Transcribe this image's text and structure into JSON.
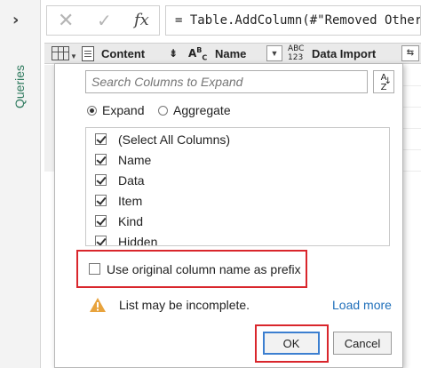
{
  "queries_pane": {
    "toggle_icon": "chevron-right-icon",
    "label": "Queries"
  },
  "formula_bar": {
    "cancel_icon": "close-icon",
    "commit_icon": "check-icon",
    "fx_label": "fx",
    "formula": "= Table.AddColumn(#\"Removed Other Columns\""
  },
  "columns": {
    "content": "Content",
    "abc_icon": "ABC",
    "name": "Name",
    "abc123_top": "ABC",
    "abc123_bottom": "123",
    "data_import": "Data Import"
  },
  "dialog": {
    "search_placeholder": "Search Columns to Expand",
    "sort_top": "A",
    "sort_bottom": "Z",
    "mode_options": [
      {
        "label": "Expand",
        "selected": true
      },
      {
        "label": "Aggregate",
        "selected": false
      }
    ],
    "column_items": [
      {
        "label": "(Select All Columns)",
        "checked": true
      },
      {
        "label": "Name",
        "checked": true
      },
      {
        "label": "Data",
        "checked": true
      },
      {
        "label": "Item",
        "checked": true
      },
      {
        "label": "Kind",
        "checked": true
      },
      {
        "label": "Hidden",
        "checked": true
      }
    ],
    "prefix_option": {
      "label": "Use original column name as prefix",
      "checked": false
    },
    "warning_text": "List may be incomplete.",
    "load_more": "Load more",
    "ok_label": "OK",
    "cancel_label": "Cancel"
  },
  "colors": {
    "highlight": "#d9262c",
    "link": "#1f6fba",
    "queries_label": "#2e7a5e",
    "warning": "#e8a33d"
  }
}
